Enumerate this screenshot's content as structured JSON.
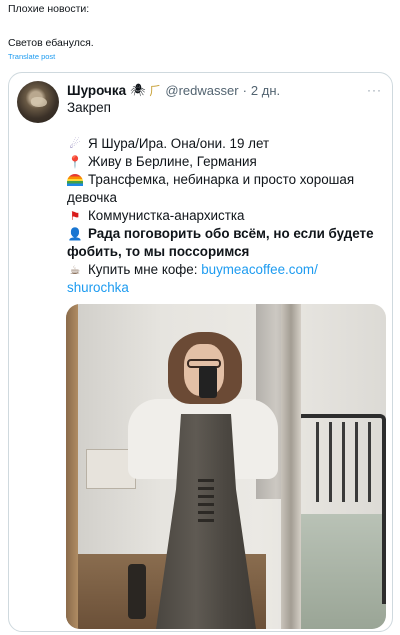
{
  "outer_post": {
    "line1": "Плохие новости:",
    "line2": "Светов ебанулся.",
    "translate_label": "Translate post"
  },
  "quoted_profile": {
    "display_name": "Шурочка",
    "name_emojis": [
      "spider-icon",
      "rainbow-icon"
    ],
    "handle": "@redwasser",
    "dot": "·",
    "time": "2 дн.",
    "more": "···",
    "pinned_label": "Закреп",
    "bio": {
      "line1": "Я Шура/Ира. Она/они. 19 лет",
      "line2": "Живу в Берлине, Германия",
      "line3a": "Трансфемка, небинарка и просто хорошая",
      "line3b": "девочка",
      "line4": "Коммунистка-анархистка",
      "line5a": "Рада поговорить обо всём, но если будете",
      "line5b": "фобить, то мы поссоримся",
      "line6_prefix": "Купить мне кофе: ",
      "line6_link_a": "buymeacoffee.com/",
      "line6_link_b": "shurochka"
    }
  },
  "icons": {
    "line1": "planet-icon",
    "line2": "pin-icon",
    "line3": "rainbow-icon",
    "line4": "flag-icon",
    "line5": "user-icon",
    "line6": "coffee-icon"
  },
  "colors": {
    "link": "#1d9bf0",
    "muted": "#536471",
    "border": "#cfd9de"
  }
}
